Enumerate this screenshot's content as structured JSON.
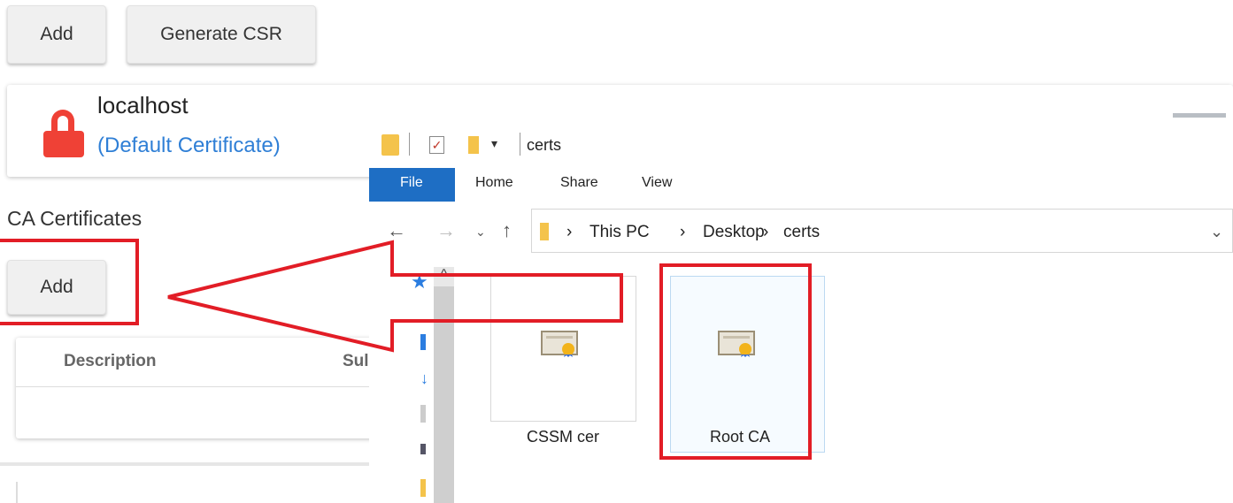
{
  "toolbar": {
    "add_label": "Add",
    "generate_csr_label": "Generate CSR"
  },
  "certificate": {
    "name": "localhost",
    "subtitle": "(Default Certificate)"
  },
  "ca_section": {
    "heading": "CA Certificates",
    "add_label": "Add",
    "columns": [
      "Description",
      "Sul"
    ]
  },
  "explorer": {
    "title": "certs",
    "tabs": {
      "file": "File",
      "home": "Home",
      "share": "Share",
      "view": "View"
    },
    "breadcrumb": [
      "This PC",
      "Desktop",
      "certs"
    ],
    "files": [
      {
        "name": "CSSM cer",
        "icon": "certificate-icon"
      },
      {
        "name": "Root CA",
        "icon": "certificate-icon"
      }
    ]
  },
  "colors": {
    "annotation_red": "#e21d26",
    "lock_red": "#ef4136",
    "link_blue": "#2f7fd6",
    "file_tab_blue": "#1e6ec4"
  }
}
